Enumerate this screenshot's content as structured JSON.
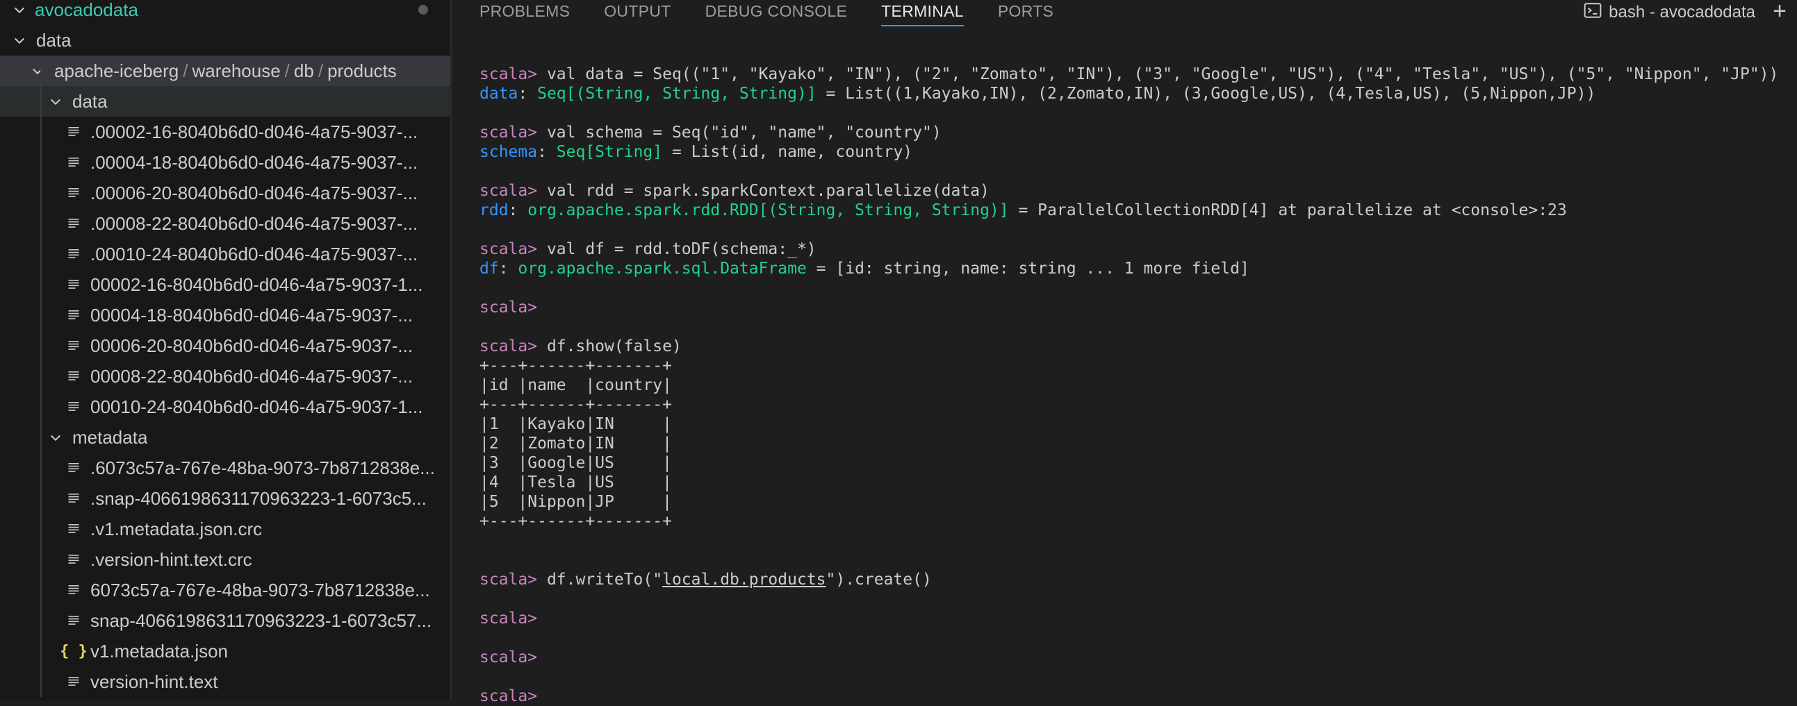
{
  "sidebar": {
    "root": "avocadodata",
    "rows": [
      {
        "kind": "folder",
        "label": "data"
      },
      {
        "kind": "folder-path",
        "parts": [
          "apache-iceberg",
          "warehouse",
          "db",
          "products"
        ]
      },
      {
        "kind": "folder",
        "label": "data"
      },
      {
        "kind": "file",
        "label": ".00002-16-8040b6d0-d046-4a75-9037-..."
      },
      {
        "kind": "file",
        "label": ".00004-18-8040b6d0-d046-4a75-9037-..."
      },
      {
        "kind": "file",
        "label": ".00006-20-8040b6d0-d046-4a75-9037-..."
      },
      {
        "kind": "file",
        "label": ".00008-22-8040b6d0-d046-4a75-9037-..."
      },
      {
        "kind": "file",
        "label": ".00010-24-8040b6d0-d046-4a75-9037-..."
      },
      {
        "kind": "file",
        "label": "00002-16-8040b6d0-d046-4a75-9037-1..."
      },
      {
        "kind": "file",
        "label": "00004-18-8040b6d0-d046-4a75-9037-..."
      },
      {
        "kind": "file",
        "label": "00006-20-8040b6d0-d046-4a75-9037-..."
      },
      {
        "kind": "file",
        "label": "00008-22-8040b6d0-d046-4a75-9037-..."
      },
      {
        "kind": "file",
        "label": "00010-24-8040b6d0-d046-4a75-9037-1..."
      },
      {
        "kind": "folder",
        "label": "metadata"
      },
      {
        "kind": "file",
        "label": ".6073c57a-767e-48ba-9073-7b8712838e..."
      },
      {
        "kind": "file",
        "label": ".snap-4066198631170963223-1-6073c5..."
      },
      {
        "kind": "file",
        "label": ".v1.metadata.json.crc"
      },
      {
        "kind": "file",
        "label": ".version-hint.text.crc"
      },
      {
        "kind": "file",
        "label": "6073c57a-767e-48ba-9073-7b8712838e..."
      },
      {
        "kind": "file",
        "label": "snap-4066198631170963223-1-6073c57..."
      },
      {
        "kind": "json",
        "label": "v1.metadata.json",
        "icon": "{ }"
      },
      {
        "kind": "file",
        "label": "version-hint.text"
      }
    ]
  },
  "panel": {
    "tabs": [
      "PROBLEMS",
      "OUTPUT",
      "DEBUG CONSOLE",
      "TERMINAL",
      "PORTS"
    ],
    "active_tab": "TERMINAL",
    "terminal_title": "bash - avocadodata",
    "new_terminal": "+"
  },
  "terminal": {
    "lines": [
      [
        {
          "t": "scala> ",
          "c": "prompt"
        },
        {
          "t": "val data = Seq((\"1\", \"Kayako\", \"IN\"), (\"2\", \"Zomato\", \"IN\"), (\"3\", \"Google\", \"US\"), (\"4\", \"Tesla\", \"US\"), (\"5\", \"Nippon\", \"JP\"))"
        }
      ],
      [
        {
          "t": "data",
          "c": "varname"
        },
        {
          "t": ": "
        },
        {
          "t": "Seq[(String, String, String)]",
          "c": "typename"
        },
        {
          "t": " = List((1,Kayako,IN), (2,Zomato,IN), (3,Google,US), (4,Tesla,US), (5,Nippon,JP))"
        }
      ],
      [],
      [
        {
          "t": "scala> ",
          "c": "prompt"
        },
        {
          "t": "val schema = Seq(\"id\", \"name\", \"country\")"
        }
      ],
      [
        {
          "t": "schema",
          "c": "varname"
        },
        {
          "t": ": "
        },
        {
          "t": "Seq[String]",
          "c": "typename"
        },
        {
          "t": " = List(id, name, country)"
        }
      ],
      [],
      [
        {
          "t": "scala> ",
          "c": "prompt"
        },
        {
          "t": "val rdd = spark.sparkContext.parallelize(data)"
        }
      ],
      [
        {
          "t": "rdd",
          "c": "varname"
        },
        {
          "t": ": "
        },
        {
          "t": "org.apache.spark.rdd.RDD[(String, String, String)]",
          "c": "typename"
        },
        {
          "t": " = ParallelCollectionRDD[4] at parallelize at <console>:23"
        }
      ],
      [],
      [
        {
          "t": "scala> ",
          "c": "prompt"
        },
        {
          "t": "val df = rdd.toDF(schema:_*)"
        }
      ],
      [
        {
          "t": "df",
          "c": "varname"
        },
        {
          "t": ": "
        },
        {
          "t": "org.apache.spark.sql.DataFrame",
          "c": "typename"
        },
        {
          "t": " = [id: string, name: string ... 1 more field]"
        }
      ],
      [],
      [
        {
          "t": "scala> ",
          "c": "prompt"
        }
      ],
      [],
      [
        {
          "t": "scala> ",
          "c": "prompt"
        },
        {
          "t": "df.show(false)"
        }
      ],
      [
        {
          "t": "+---+------+-------+"
        }
      ],
      [
        {
          "t": "|id |name  |country|"
        }
      ],
      [
        {
          "t": "+---+------+-------+"
        }
      ],
      [
        {
          "t": "|1  |Kayako|IN     |"
        }
      ],
      [
        {
          "t": "|2  |Zomato|IN     |"
        }
      ],
      [
        {
          "t": "|3  |Google|US     |"
        }
      ],
      [
        {
          "t": "|4  |Tesla |US     |"
        }
      ],
      [
        {
          "t": "|5  |Nippon|JP     |"
        }
      ],
      [
        {
          "t": "+---+------+-------+"
        }
      ],
      [],
      [],
      [
        {
          "t": "scala> ",
          "c": "prompt"
        },
        {
          "t": "df.writeTo(\""
        },
        {
          "t": "local.db.products",
          "c": "ul"
        },
        {
          "t": "\").create()"
        }
      ],
      [],
      [
        {
          "t": "scala> ",
          "c": "prompt"
        }
      ],
      [],
      [
        {
          "t": "scala> ",
          "c": "prompt"
        }
      ],
      [],
      [
        {
          "t": "scala> ",
          "c": "prompt"
        }
      ]
    ]
  }
}
